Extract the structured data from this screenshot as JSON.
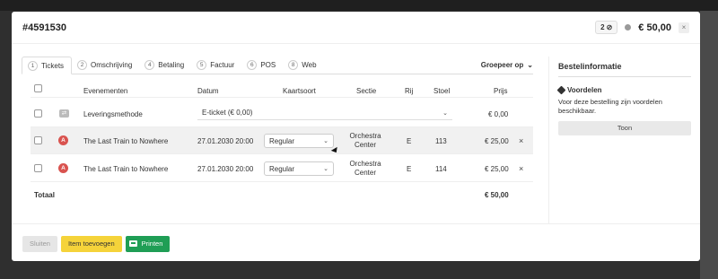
{
  "header": {
    "order_number": "#4591530",
    "ticket_count": "2",
    "ticket_icon": "ticket-icon",
    "status_dot_color": "#9a9a9a",
    "total": "€ 50,00",
    "close_label": "×"
  },
  "tabs": [
    {
      "num": "1",
      "label": "Tickets",
      "active": true
    },
    {
      "num": "2",
      "label": "Omschrijving"
    },
    {
      "num": "4",
      "label": "Betaling"
    },
    {
      "num": "5",
      "label": "Factuur"
    },
    {
      "num": "6",
      "label": "POS"
    },
    {
      "num": "8",
      "label": "Web"
    }
  ],
  "group_by": {
    "label": "Groepeer op",
    "icon": "chevron-down-icon"
  },
  "table": {
    "columns": [
      "Evenementen",
      "Datum",
      "Kaartsoort",
      "Sectie",
      "Rij",
      "Stoel",
      "Prijs"
    ],
    "delivery": {
      "icon": "delivery-icon",
      "label": "Leveringsmethode",
      "method": "E-ticket (€ 0,00)",
      "price": "€ 0,00"
    },
    "rows": [
      {
        "badge": "A",
        "event": "The Last Train to Nowhere",
        "date": "27.01.2030 20:00",
        "type": "Regular",
        "section": "Orchestra Center",
        "row": "E",
        "seat": "113",
        "price": "€ 25,00",
        "delete": "×"
      },
      {
        "badge": "A",
        "event": "The Last Train to Nowhere",
        "date": "27.01.2030 20:00",
        "type": "Regular",
        "section": "Orchestra Center",
        "row": "E",
        "seat": "114",
        "price": "€ 25,00",
        "delete": "×"
      }
    ],
    "total_label": "Totaal",
    "total_value": "€ 50,00"
  },
  "sidebar": {
    "title": "Bestelinformatie",
    "subtitle": "Voordelen",
    "text": "Voor deze bestelling zijn voordelen beschikbaar.",
    "button": "Toon"
  },
  "footer": {
    "close": "Sluiten",
    "add": "Item toevoegen",
    "print": "Printen"
  },
  "colors": {
    "accent_green": "#1f9e55",
    "accent_yellow": "#f5d33a",
    "badge_red": "#d9534f"
  }
}
